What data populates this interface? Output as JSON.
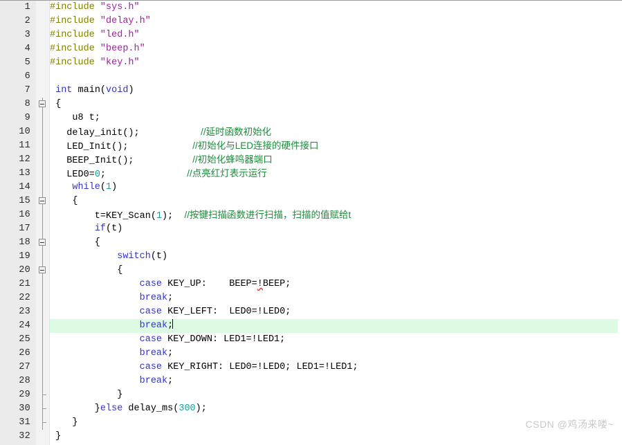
{
  "editor": {
    "language": "c",
    "total_lines": 32,
    "current_line": 24,
    "colors": {
      "background": "#ffffff",
      "gutter_background": "#ebebeb",
      "fold_background": "#f3f3f3",
      "current_line_highlight": "#ddfbe3",
      "preprocessor": "#808000",
      "string": "#a020a0",
      "keyword": "#3333cc",
      "number": "#1a9a9a",
      "comment": "#1f8a3c",
      "plain_text": "#000000",
      "error_squiggle": "#e03030",
      "watermark": "#c8c8c8"
    }
  },
  "lines": [
    {
      "no": "1",
      "fold": "none",
      "indent": 0,
      "tokens": [
        {
          "t": "pre",
          "v": "#include"
        },
        {
          "t": "plain",
          "v": " "
        },
        {
          "t": "str",
          "v": "\"sys.h\""
        }
      ]
    },
    {
      "no": "2",
      "fold": "none",
      "indent": 0,
      "tokens": [
        {
          "t": "pre",
          "v": "#include"
        },
        {
          "t": "plain",
          "v": " "
        },
        {
          "t": "str",
          "v": "\"delay.h\""
        }
      ]
    },
    {
      "no": "3",
      "fold": "none",
      "indent": 0,
      "tokens": [
        {
          "t": "pre",
          "v": "#include"
        },
        {
          "t": "plain",
          "v": " "
        },
        {
          "t": "str",
          "v": "\"led.h\""
        }
      ]
    },
    {
      "no": "4",
      "fold": "none",
      "indent": 0,
      "tokens": [
        {
          "t": "pre",
          "v": "#include"
        },
        {
          "t": "plain",
          "v": " "
        },
        {
          "t": "str",
          "v": "\"beep.h\""
        }
      ]
    },
    {
      "no": "5",
      "fold": "none",
      "indent": 0,
      "tokens": [
        {
          "t": "pre",
          "v": "#include"
        },
        {
          "t": "plain",
          "v": " "
        },
        {
          "t": "str",
          "v": "\"key.h\""
        }
      ]
    },
    {
      "no": "6",
      "fold": "none",
      "indent": 0,
      "tokens": []
    },
    {
      "no": "7",
      "fold": "none",
      "indent": 0,
      "tokens": [
        {
          "t": "plain",
          "v": " "
        },
        {
          "t": "kw",
          "v": "int"
        },
        {
          "t": "plain",
          "v": " main("
        },
        {
          "t": "kw",
          "v": "void"
        },
        {
          "t": "plain",
          "v": ")"
        }
      ]
    },
    {
      "no": "8",
      "fold": "box",
      "indent": 0,
      "tokens": [
        {
          "t": "plain",
          "v": " {"
        }
      ]
    },
    {
      "no": "9",
      "fold": "line",
      "indent": 0,
      "tokens": [
        {
          "t": "plain",
          "v": "    u8 t;"
        }
      ]
    },
    {
      "no": "10",
      "fold": "line",
      "indent": 0,
      "tokens": [
        {
          "t": "plain",
          "v": "   delay_init();"
        },
        {
          "t": "plain",
          "v": "          "
        },
        {
          "t": "cmt",
          "v": "  //延时函数初始化"
        }
      ]
    },
    {
      "no": "11",
      "fold": "line",
      "indent": 0,
      "tokens": [
        {
          "t": "plain",
          "v": "   LED_Init();"
        },
        {
          "t": "plain",
          "v": "           "
        },
        {
          "t": "cmt",
          "v": " //初始化与LED连接的硬件接口"
        }
      ]
    },
    {
      "no": "12",
      "fold": "line",
      "indent": 0,
      "tokens": [
        {
          "t": "plain",
          "v": "   BEEP_Init();"
        },
        {
          "t": "plain",
          "v": "          "
        },
        {
          "t": "cmt",
          "v": " //初始化蜂鸣器端口"
        }
      ]
    },
    {
      "no": "13",
      "fold": "line",
      "indent": 0,
      "tokens": [
        {
          "t": "plain",
          "v": "   LED0="
        },
        {
          "t": "num",
          "v": "0"
        },
        {
          "t": "plain",
          "v": ";"
        },
        {
          "t": "plain",
          "v": "              "
        },
        {
          "t": "cmt",
          "v": " //点亮红灯表示运行"
        }
      ]
    },
    {
      "no": "14",
      "fold": "line",
      "indent": 0,
      "tokens": [
        {
          "t": "plain",
          "v": "    "
        },
        {
          "t": "kw",
          "v": "while"
        },
        {
          "t": "plain",
          "v": "("
        },
        {
          "t": "num",
          "v": "1"
        },
        {
          "t": "plain",
          "v": ")"
        }
      ]
    },
    {
      "no": "15",
      "fold": "box",
      "indent": 0,
      "tokens": [
        {
          "t": "plain",
          "v": "    {"
        }
      ]
    },
    {
      "no": "16",
      "fold": "line",
      "indent": 0,
      "tokens": [
        {
          "t": "plain",
          "v": "        t=KEY_Scan("
        },
        {
          "t": "num",
          "v": "1"
        },
        {
          "t": "plain",
          "v": ");  "
        },
        {
          "t": "cmt",
          "v": "//按键扫描函数进行扫描，扫描的值赋给t"
        }
      ]
    },
    {
      "no": "17",
      "fold": "line",
      "indent": 0,
      "tokens": [
        {
          "t": "plain",
          "v": "        "
        },
        {
          "t": "kw",
          "v": "if"
        },
        {
          "t": "plain",
          "v": "(t)"
        }
      ]
    },
    {
      "no": "18",
      "fold": "box",
      "indent": 0,
      "tokens": [
        {
          "t": "plain",
          "v": "        {"
        }
      ]
    },
    {
      "no": "19",
      "fold": "line",
      "indent": 0,
      "tokens": [
        {
          "t": "plain",
          "v": "            "
        },
        {
          "t": "kw",
          "v": "switch"
        },
        {
          "t": "plain",
          "v": "(t)"
        }
      ]
    },
    {
      "no": "20",
      "fold": "box",
      "indent": 0,
      "tokens": [
        {
          "t": "plain",
          "v": "            {"
        }
      ]
    },
    {
      "no": "21",
      "fold": "line",
      "indent": 0,
      "tokens": [
        {
          "t": "plain",
          "v": "                "
        },
        {
          "t": "kw",
          "v": "case"
        },
        {
          "t": "plain",
          "v": " KEY_UP:    BEEP="
        },
        {
          "t": "err",
          "v": "!"
        },
        {
          "t": "plain",
          "v": "BEEP;"
        }
      ]
    },
    {
      "no": "22",
      "fold": "line",
      "indent": 0,
      "tokens": [
        {
          "t": "plain",
          "v": "                "
        },
        {
          "t": "kw",
          "v": "break"
        },
        {
          "t": "plain",
          "v": ";"
        }
      ]
    },
    {
      "no": "23",
      "fold": "line",
      "indent": 0,
      "tokens": [
        {
          "t": "plain",
          "v": "                "
        },
        {
          "t": "kw",
          "v": "case"
        },
        {
          "t": "plain",
          "v": " KEY_LEFT:  LED0=!LED0;"
        }
      ]
    },
    {
      "no": "24",
      "fold": "line",
      "indent": 0,
      "current": true,
      "tokens": [
        {
          "t": "plain",
          "v": "                "
        },
        {
          "t": "kw",
          "v": "break"
        },
        {
          "t": "plain",
          "v": ";"
        },
        {
          "t": "caret",
          "v": ""
        }
      ]
    },
    {
      "no": "25",
      "fold": "line",
      "indent": 0,
      "tokens": [
        {
          "t": "plain",
          "v": "                "
        },
        {
          "t": "kw",
          "v": "case"
        },
        {
          "t": "plain",
          "v": " KEY_DOWN: LED1=!LED1;"
        }
      ]
    },
    {
      "no": "26",
      "fold": "line",
      "indent": 0,
      "tokens": [
        {
          "t": "plain",
          "v": "                "
        },
        {
          "t": "kw",
          "v": "break"
        },
        {
          "t": "plain",
          "v": ";"
        }
      ]
    },
    {
      "no": "27",
      "fold": "line",
      "indent": 0,
      "tokens": [
        {
          "t": "plain",
          "v": "                "
        },
        {
          "t": "kw",
          "v": "case"
        },
        {
          "t": "plain",
          "v": " KEY_RIGHT: LED0=!LED0; LED1=!LED1;"
        }
      ]
    },
    {
      "no": "28",
      "fold": "line",
      "indent": 0,
      "tokens": [
        {
          "t": "plain",
          "v": "                "
        },
        {
          "t": "kw",
          "v": "break"
        },
        {
          "t": "plain",
          "v": ";"
        }
      ]
    },
    {
      "no": "29",
      "fold": "end",
      "indent": 0,
      "tokens": [
        {
          "t": "plain",
          "v": "            }"
        }
      ]
    },
    {
      "no": "30",
      "fold": "end",
      "indent": 0,
      "tokens": [
        {
          "t": "plain",
          "v": "        }"
        },
        {
          "t": "kw",
          "v": "else"
        },
        {
          "t": "plain",
          "v": " delay_ms("
        },
        {
          "t": "num",
          "v": "300"
        },
        {
          "t": "plain",
          "v": ");"
        }
      ]
    },
    {
      "no": "31",
      "fold": "end",
      "indent": 0,
      "tokens": [
        {
          "t": "plain",
          "v": "    }"
        }
      ]
    },
    {
      "no": "32",
      "fold": "endlast",
      "indent": 0,
      "tokens": [
        {
          "t": "plain",
          "v": " }"
        }
      ]
    }
  ],
  "watermark": {
    "text": "CSDN @鸡汤来喽~"
  }
}
